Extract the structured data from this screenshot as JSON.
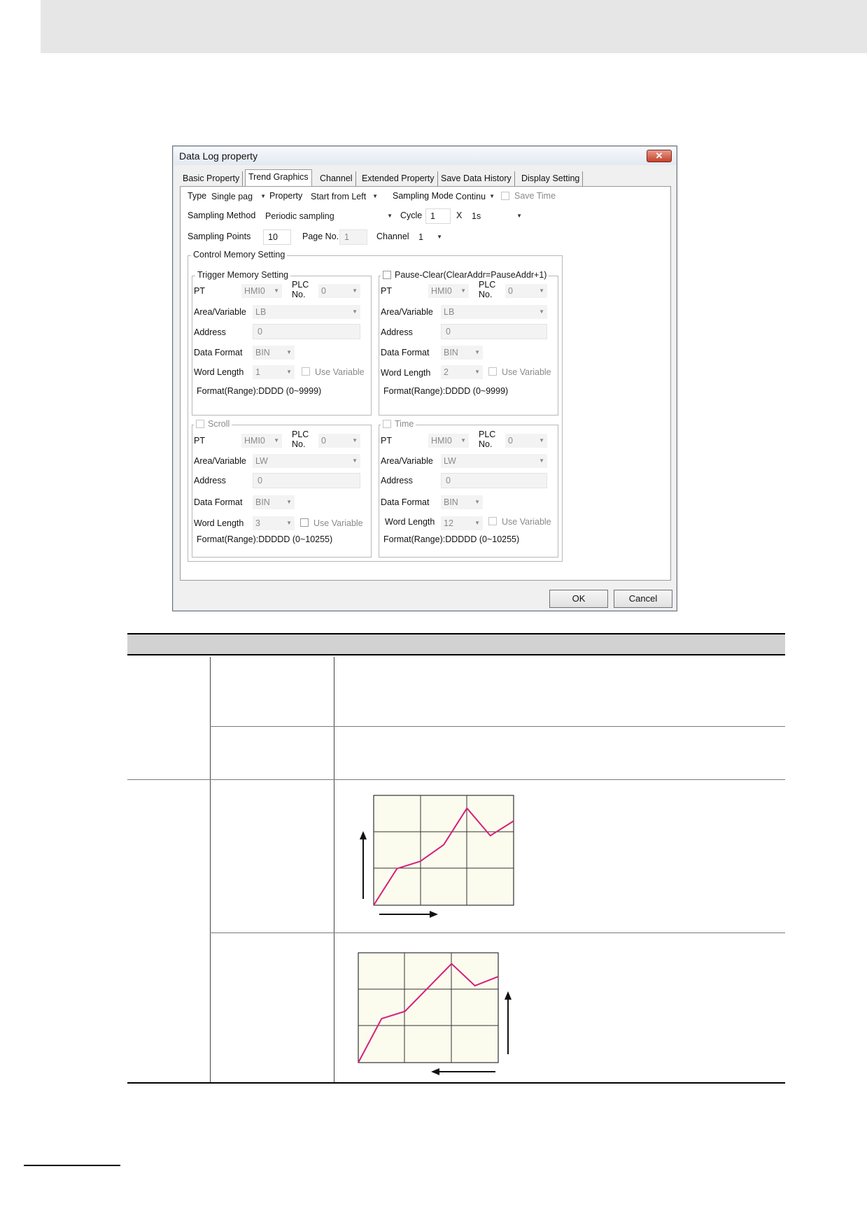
{
  "dialog": {
    "title": "Data Log property",
    "close_glyph": "✕",
    "tabs": [
      "Basic Property",
      "Trend Graphics",
      "Channel",
      "Extended Property",
      "Save Data History",
      "Display Setting"
    ],
    "row1": {
      "type_label": "Type",
      "type_value": "Single pag",
      "property_label": "Property",
      "property_value": "Start from Left",
      "sampling_mode_label": "Sampling Mode",
      "sampling_mode_value": "Continu",
      "save_time_label": "Save Time"
    },
    "row2": {
      "sampling_method_label": "Sampling Method",
      "sampling_method_value": "Periodic sampling",
      "cycle_label": "Cycle",
      "cycle_value": "1",
      "x_label": "X",
      "unit_value": "1s"
    },
    "row3": {
      "sampling_points_label": "Sampling Points",
      "sampling_points_value": "10",
      "page_no_label": "Page No.",
      "page_no_value": "1",
      "channel_label": "Channel",
      "channel_value": "1"
    },
    "control_memory_title": "Control Memory Setting",
    "labels": {
      "pt": "PT",
      "plc": "PLC",
      "no": "No.",
      "area": "Area/Variable",
      "address": "Address",
      "data_format": "Data Format",
      "word_length": "Word Length",
      "use_variable": "Use Variable"
    },
    "groups": {
      "trigger": {
        "title": "Trigger Memory Setting",
        "pt": "HMI0",
        "plc_no": "0",
        "area": "LB",
        "address": "0",
        "data_format": "BIN",
        "word_length": "1",
        "format_range": "Format(Range):DDDD (0~9999)"
      },
      "pause": {
        "title": "Pause-Clear(ClearAddr=PauseAddr+1)",
        "pt": "HMI0",
        "plc_no": "0",
        "area": "LB",
        "address": "0",
        "data_format": "BIN",
        "word_length": "2",
        "format_range": "Format(Range):DDDD (0~9999)"
      },
      "scroll": {
        "title": "Scroll",
        "pt": "HMI0",
        "plc_no": "0",
        "area": "LW",
        "address": "0",
        "data_format": "BIN",
        "word_length": "3",
        "format_range": "Format(Range):DDDDD (0~10255)"
      },
      "time": {
        "title": "Time",
        "pt": "HMI0",
        "plc_no": "0",
        "area": "LW",
        "address": "0",
        "data_format": "BIN",
        "word_length": "12",
        "format_range": "Format(Range):DDDDD (0~10255)"
      }
    },
    "ok_label": "OK",
    "cancel_label": "Cancel"
  },
  "colors": {
    "trend_line": "#d4207a",
    "grid_bg": "#fbfbee"
  },
  "trend_diagrams": [
    {
      "direction": "start-from-left",
      "values": [
        0,
        2,
        2.4,
        3.3,
        5.3,
        3.8,
        4.6
      ]
    },
    {
      "direction": "start-from-right",
      "values": [
        0,
        2.4,
        2.8,
        4.1,
        5.4,
        4.2,
        4.7
      ]
    }
  ]
}
